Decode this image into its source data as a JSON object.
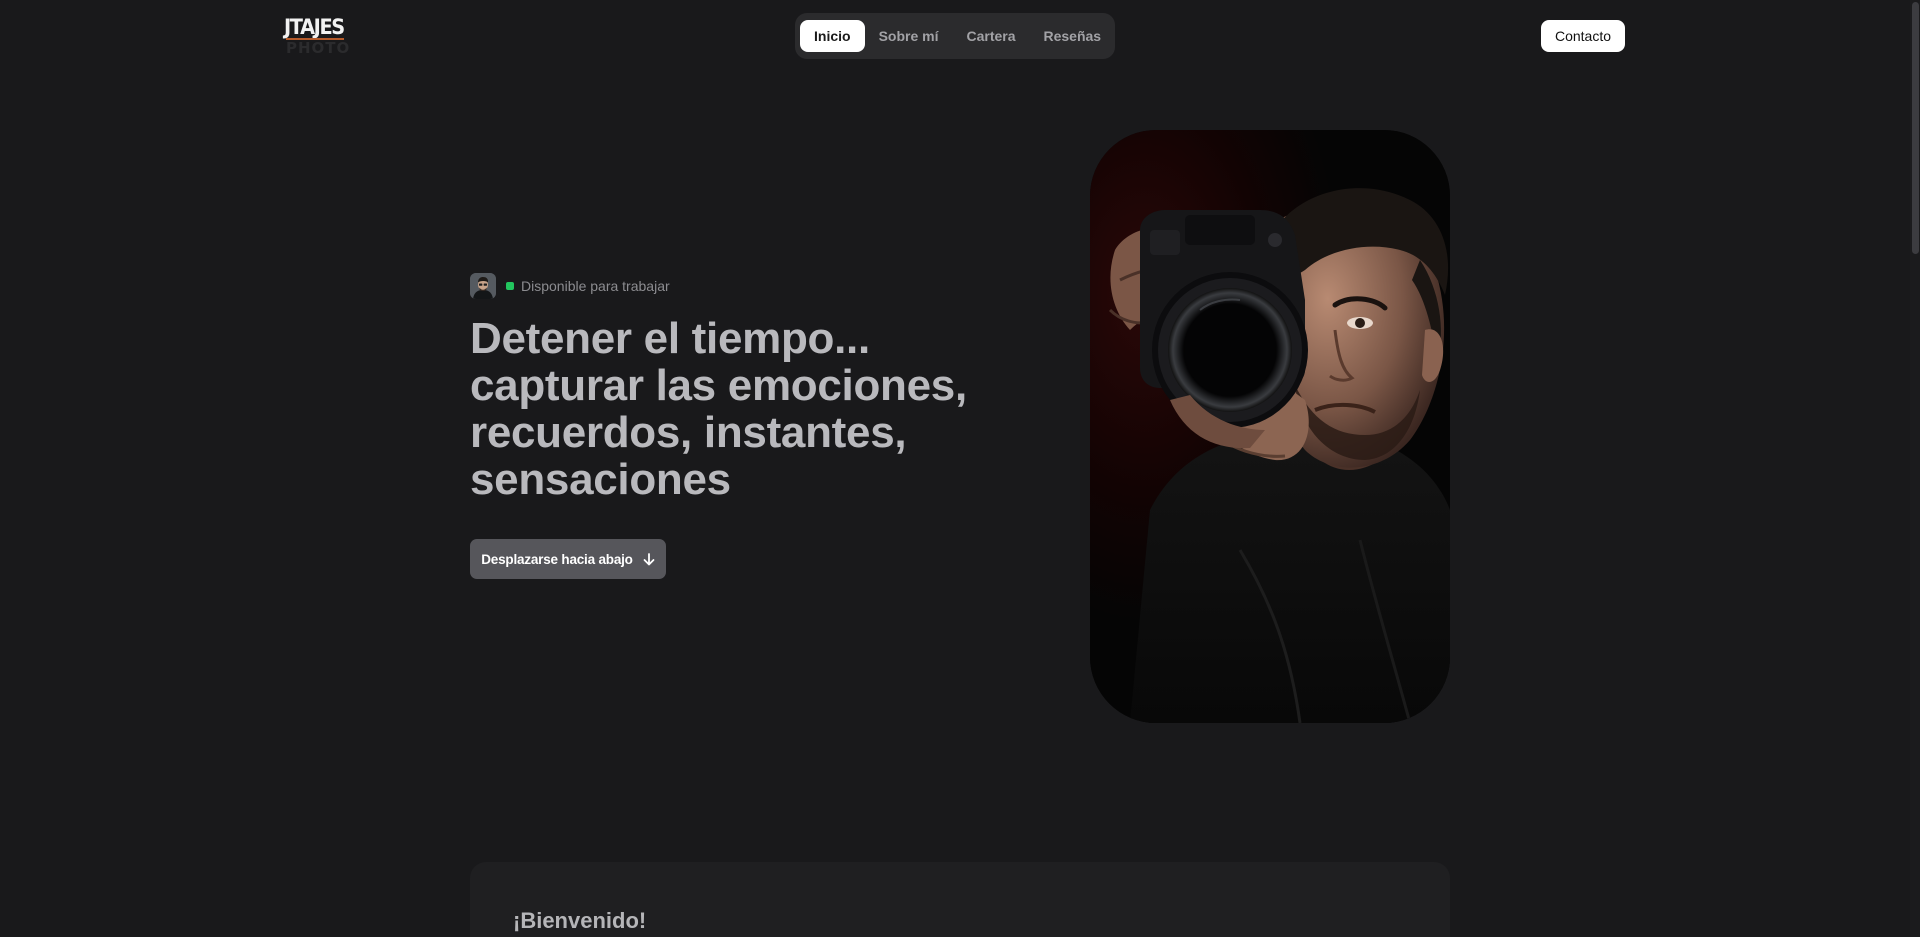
{
  "brand": {
    "logo_main": "JTAJES",
    "logo_sub": "PHOTO"
  },
  "nav": {
    "items": [
      {
        "label": "Inicio",
        "active": true
      },
      {
        "label": "Sobre mí",
        "active": false
      },
      {
        "label": "Cartera",
        "active": false
      },
      {
        "label": "Reseñas",
        "active": false
      }
    ]
  },
  "header": {
    "contact_label": "Contacto"
  },
  "hero": {
    "status_text": "Disponible para trabajar",
    "status_color": "#22c55e",
    "headline_lines": [
      "Detener el tiempo...",
      "capturar las emociones,",
      "recuerdos, instantes,",
      "sensaciones"
    ],
    "scroll_button_label": "Desplazarse hacia abajo",
    "scroll_icon": "arrow-down-icon",
    "photo_icon": "photographer-portrait"
  },
  "welcome": {
    "title": "¡Bienvenido!"
  }
}
